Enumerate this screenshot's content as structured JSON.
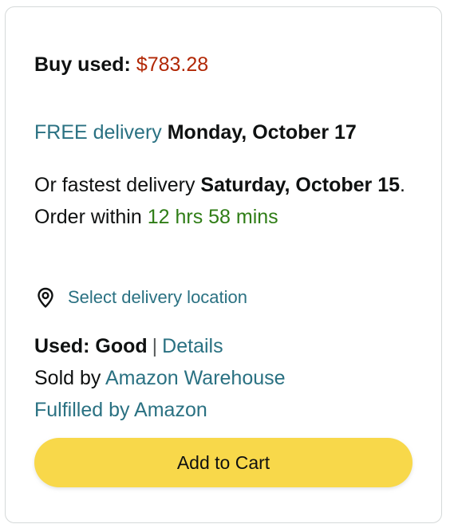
{
  "buy_box": {
    "buy_used_label": "Buy used:",
    "price": "$783.28",
    "free_delivery_link": "FREE delivery",
    "free_delivery_date": "Monday, October 17",
    "fastest_prefix": "Or fastest delivery",
    "fastest_date": "Saturday, October 15",
    "order_within_prefix": ". Order within",
    "order_within_time": "12 hrs 58 mins",
    "location_icon": "location-pin-icon",
    "location_link": "Select delivery location",
    "condition_label": "Used: Good",
    "separator": "|",
    "details_link": "Details",
    "sold_by_prefix": "Sold by",
    "seller_link": "Amazon Warehouse",
    "fulfilled_link": "Fulfilled by Amazon",
    "add_to_cart_label": "Add to Cart"
  },
  "colors": {
    "price": "#b12704",
    "link": "#2a7182",
    "countdown": "#2f7d16",
    "cart_button": "#f8d84a",
    "border": "#d5d9d9"
  }
}
